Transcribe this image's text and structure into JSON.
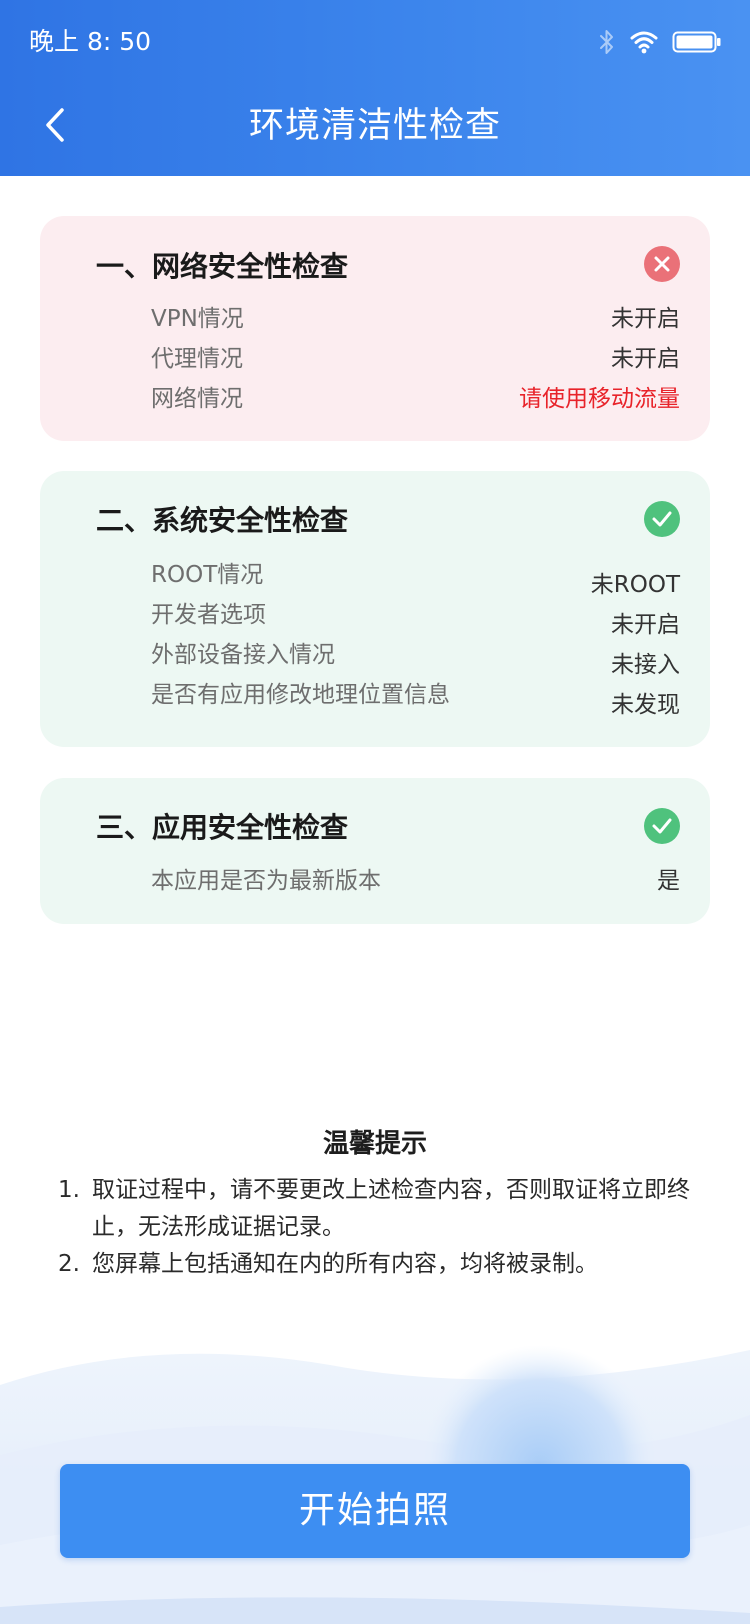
{
  "status_bar": {
    "time": "晚上 8: 50",
    "icons": [
      "bluetooth-icon",
      "wifi-icon",
      "battery-icon"
    ]
  },
  "header": {
    "title": "环境清洁性检查",
    "back_icon": "chevron-left-icon"
  },
  "colors": {
    "header_gradient_start": "#2f74e4",
    "header_gradient_end": "#4a92f2",
    "fail_card_bg": "#fcedf0",
    "pass_card_bg": "#edf8f3",
    "error_icon": "#ea7178",
    "ok_icon": "#4fc27d",
    "warning_text": "#e8232a",
    "button_bg": "#3d8ef2"
  },
  "sections": [
    {
      "title": "一、网络安全性检查",
      "status": "fail",
      "status_icon": "close-circle-icon",
      "rows": [
        {
          "label": "VPN情况",
          "value": "未开启",
          "warn": false
        },
        {
          "label": "代理情况",
          "value": "未开启",
          "warn": false
        },
        {
          "label": "网络情况",
          "value": "请使用移动流量",
          "warn": true
        }
      ]
    },
    {
      "title": "二、系统安全性检查",
      "status": "pass",
      "status_icon": "check-circle-icon",
      "rows": [
        {
          "label": "ROOT情况",
          "value": "未ROOT"
        },
        {
          "label": "开发者选项",
          "value": "未开启"
        },
        {
          "label": "外部设备接入情况",
          "value": "未接入"
        },
        {
          "label": "是否有应用修改地理位置信息",
          "value": "未发现"
        }
      ]
    },
    {
      "title": "三、应用安全性检查",
      "status": "pass",
      "status_icon": "check-circle-icon",
      "rows": [
        {
          "label": "本应用是否为最新版本",
          "value": "是"
        }
      ]
    }
  ],
  "tips": {
    "title": "温馨提示",
    "items": [
      {
        "num": "1.",
        "text": "取证过程中，请不要更改上述检查内容，否则取证将立即终止，无法形成证据记录。"
      },
      {
        "num": "2.",
        "text": "您屏幕上包括通知在内的所有内容，均将被录制。"
      }
    ]
  },
  "start_button": {
    "label": "开始拍照"
  }
}
